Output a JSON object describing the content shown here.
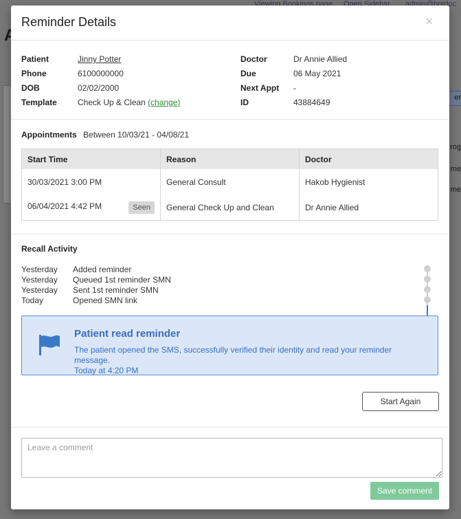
{
  "background": {
    "topbar_links": [
      "Viewing Bookings page",
      "Open Sidebar",
      "admin@hotdoc"
    ],
    "page_title_initial": "A",
    "right_fragments": [
      "er",
      "rog",
      "me",
      "me"
    ]
  },
  "modal": {
    "title": "Reminder Details",
    "close_glyph": "×"
  },
  "details": {
    "patient_label": "Patient",
    "patient_value": "Jinny Potter",
    "phone_label": "Phone",
    "phone_value": "6100000000",
    "dob_label": "DOB",
    "dob_value": "02/02/2000",
    "template_label": "Template",
    "template_value": "Check Up & Clean",
    "template_change": "(change)",
    "doctor_label": "Doctor",
    "doctor_value": "Dr Annie Allied",
    "due_label": "Due",
    "due_value": "06 May 2021",
    "next_appt_label": "Next Appt",
    "next_appt_value": "-",
    "id_label": "ID",
    "id_value": "43884649"
  },
  "appointments": {
    "label": "Appointments",
    "range": "Between 10/03/21 - 04/08/21",
    "columns": [
      "Start Time",
      "Reason",
      "Doctor"
    ],
    "rows": [
      {
        "start": "30/03/2021 3:00 PM",
        "badge": "",
        "reason": "General Consult",
        "doctor": "Hakob Hygienist"
      },
      {
        "start": "06/04/2021 4:42 PM",
        "badge": "Seen",
        "reason": "General Check Up and Clean",
        "doctor": "Dr Annie Allied"
      }
    ]
  },
  "recall": {
    "title": "Recall Activity",
    "activities": [
      {
        "when": "Yesterday",
        "what": "Added reminder"
      },
      {
        "when": "Yesterday",
        "what": "Queued 1st reminder SMN"
      },
      {
        "when": "Yesterday",
        "what": "Sent 1st reminder SMN"
      },
      {
        "when": "Today",
        "what": "Opened SMN link"
      }
    ],
    "callout_title": "Patient read reminder",
    "callout_body": "The patient opened the SMS, successfully verified their identity and read your reminder message.",
    "callout_time": "Today at 4:20 PM",
    "callout_icon": "flag-icon",
    "start_again_label": "Start Again",
    "accent_color": "#3c78c8"
  },
  "comment": {
    "placeholder": "Leave a comment",
    "save_label": "Save comment"
  }
}
